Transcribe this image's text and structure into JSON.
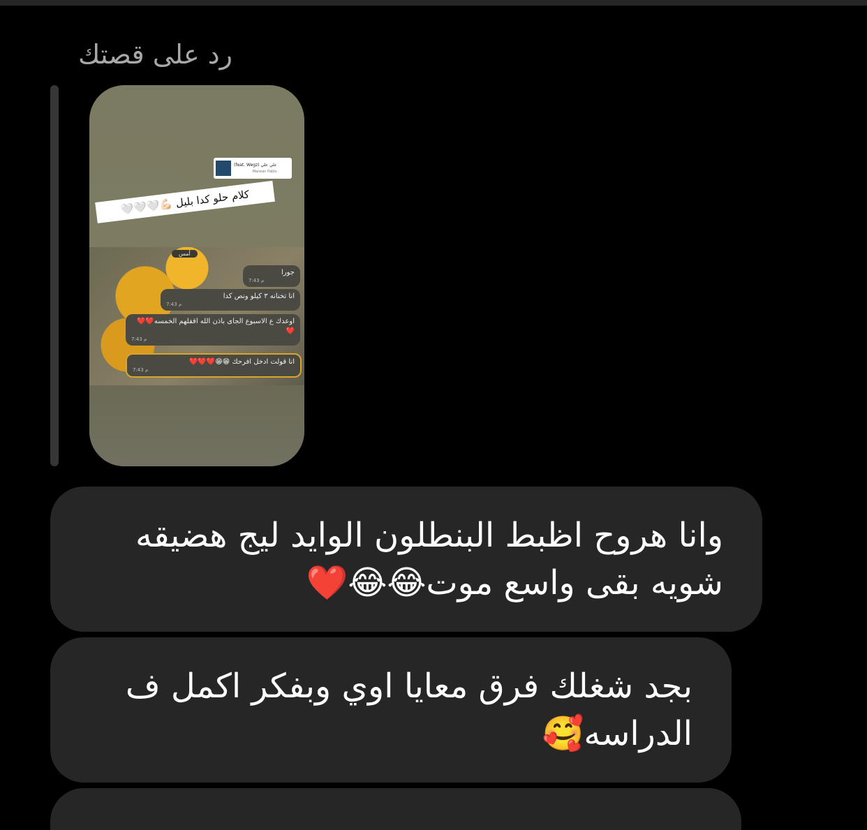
{
  "reply": {
    "label": "رد على قصتك"
  },
  "story": {
    "music_title": "علي علي (feat. Wegz)",
    "music_artist": "Marwan Pablo",
    "text_sticker": "كلام حلو كدا بليل 💪🏻🤍🤍🤍",
    "chat": {
      "date_chip": "أمس",
      "messages": [
        {
          "text": "جورا",
          "time": "7:43 م"
        },
        {
          "text": "انا تخنانه ٣ كيلو ونص كدا",
          "time": "7:43 م"
        },
        {
          "text": "اوعدك ع الاسبوع الجاى باذن الله اقفلهم الخمسه❤️❤️❤️",
          "time": "7:43 م"
        },
        {
          "text": "انا قولت ادخل افرحك 😁😁❤️❤️❤️",
          "time": "7:43 م"
        }
      ]
    }
  },
  "messages": [
    {
      "line1": "وانا هروح اظبط البنطلون الوايد ليج هضيقه",
      "line2": "شويه بقى واسع موت😂😂❤️"
    },
    {
      "line1": "بجد شغلك فرق معايا اوي وبفكر اكمل ف",
      "line2": "الدراسه🥰"
    }
  ],
  "colors": {
    "background": "#000000",
    "bubble": "#262626",
    "reply_label": "#a8a8a8",
    "reply_line": "#363636"
  }
}
